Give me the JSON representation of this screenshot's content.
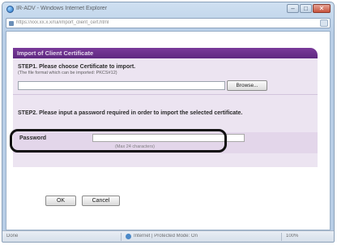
{
  "window": {
    "title": "IR-ADV - Windows Internet Explorer",
    "url": "https://xxx.xx.x.x/rui/import_client_cert.html"
  },
  "controls": {
    "minimize": "–",
    "maximize": "□",
    "close": "✕"
  },
  "page": {
    "header_title": "Import of Client Certificate",
    "step1": {
      "title": "STEP1. Please choose Certificate to import.",
      "note": "(The file format which can be imported: PKCS#12)",
      "browse_label": "Browse..."
    },
    "step2": {
      "title": "STEP2. Please input a password required in order to import the selected certificate.",
      "password_label": "Password",
      "password_value": "",
      "password_hint": "(Max 24 characters)"
    },
    "buttons": {
      "ok": "OK",
      "cancel": "Cancel"
    }
  },
  "status": {
    "left": "Done",
    "zone": "Internet | Protected Mode: On",
    "zoom": "100%"
  },
  "colors": {
    "header": "#6b2f8e",
    "panel": "#ece4f1",
    "highlight": "#111111"
  }
}
